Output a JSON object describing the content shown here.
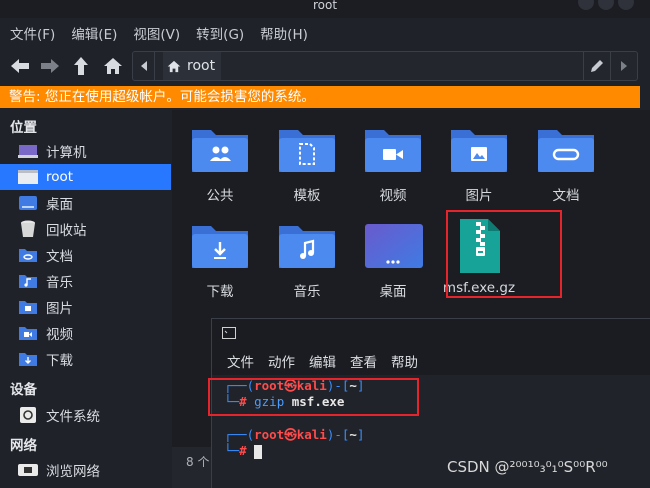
{
  "window": {
    "title": "root"
  },
  "menubar": [
    "文件(F)",
    "编辑(E)",
    "视图(V)",
    "转到(G)",
    "帮助(H)"
  ],
  "pathbar": {
    "crumb": "root"
  },
  "warning": "警告: 您正在使用超级帐户。可能会损害您的系统。",
  "sidebar": {
    "section_places": "位置",
    "section_devices": "设备",
    "section_network": "网络",
    "places": [
      {
        "label": "计算机",
        "icon": "computer-icon"
      },
      {
        "label": "root",
        "icon": "home-folder-icon"
      },
      {
        "label": "桌面",
        "icon": "desktop-icon"
      },
      {
        "label": "回收站",
        "icon": "trash-icon"
      },
      {
        "label": "文档",
        "icon": "documents-icon"
      },
      {
        "label": "音乐",
        "icon": "music-icon"
      },
      {
        "label": "图片",
        "icon": "pictures-icon"
      },
      {
        "label": "视频",
        "icon": "videos-icon"
      },
      {
        "label": "下载",
        "icon": "downloads-icon"
      }
    ],
    "devices": [
      {
        "label": "文件系统",
        "icon": "drive-icon"
      }
    ],
    "network": [
      {
        "label": "浏览网络",
        "icon": "network-icon"
      }
    ]
  },
  "files": [
    {
      "label": "公共",
      "icon": "public-folder-icon"
    },
    {
      "label": "模板",
      "icon": "templates-folder-icon"
    },
    {
      "label": "视频",
      "icon": "videos-folder-icon"
    },
    {
      "label": "图片",
      "icon": "pictures-folder-icon"
    },
    {
      "label": "文档",
      "icon": "documents-folder-icon"
    },
    {
      "label": "下载",
      "icon": "downloads-folder-icon"
    },
    {
      "label": "音乐",
      "icon": "music-folder-icon"
    },
    {
      "label": "桌面",
      "icon": "desktop-folder-icon"
    },
    {
      "label": "msf.exe.gz",
      "icon": "archive-file-icon"
    }
  ],
  "statusbar": {
    "text": "8 个"
  },
  "terminal": {
    "menu": [
      "文件",
      "动作",
      "编辑",
      "查看",
      "帮助"
    ],
    "prompt1": {
      "open": "┌──(",
      "user": "root㉿kali",
      "mid": ")-[",
      "dir": "~",
      "close": "]",
      "line2": "└─",
      "hash": "#",
      "command": " gzip ",
      "arg": "msf.exe"
    },
    "prompt2": {
      "open": "┌──(",
      "user": "root㉿kali",
      "mid": ")-[",
      "dir": "~",
      "close": "]",
      "line2": "└─",
      "hash": "#"
    }
  },
  "watermark": "CSDN @²⁰⁰¹⁰₃⁰₁⁰S⁰⁰R⁰⁰"
}
